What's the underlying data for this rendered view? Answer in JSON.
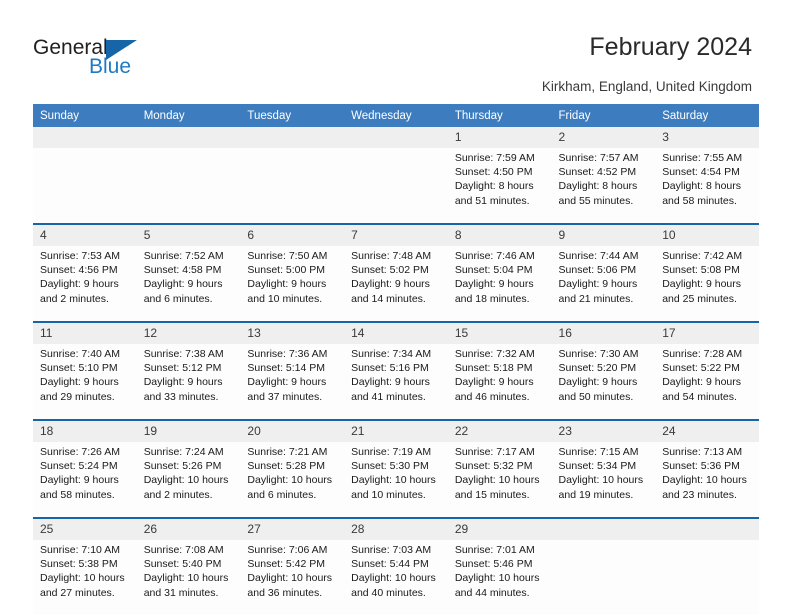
{
  "brand": {
    "name_part1": "General",
    "name_part2": "Blue",
    "accent_color": "#1565a8"
  },
  "header": {
    "title": "February 2024",
    "subtitle": "Kirkham, England, United Kingdom"
  },
  "theme": {
    "header_row_bg": "#3d7cbf",
    "week_separator": "#1565a8",
    "daynum_band": "#efefef"
  },
  "calendar": {
    "weekday_headers": [
      "Sunday",
      "Monday",
      "Tuesday",
      "Wednesday",
      "Thursday",
      "Friday",
      "Saturday"
    ],
    "weeks": [
      [
        {
          "day": "",
          "lines": [
            "",
            "",
            "",
            ""
          ]
        },
        {
          "day": "",
          "lines": [
            "",
            "",
            "",
            ""
          ]
        },
        {
          "day": "",
          "lines": [
            "",
            "",
            "",
            ""
          ]
        },
        {
          "day": "",
          "lines": [
            "",
            "",
            "",
            ""
          ]
        },
        {
          "day": "1",
          "lines": [
            "Sunrise: 7:59 AM",
            "Sunset: 4:50 PM",
            "Daylight: 8 hours",
            "and 51 minutes."
          ]
        },
        {
          "day": "2",
          "lines": [
            "Sunrise: 7:57 AM",
            "Sunset: 4:52 PM",
            "Daylight: 8 hours",
            "and 55 minutes."
          ]
        },
        {
          "day": "3",
          "lines": [
            "Sunrise: 7:55 AM",
            "Sunset: 4:54 PM",
            "Daylight: 8 hours",
            "and 58 minutes."
          ]
        }
      ],
      [
        {
          "day": "4",
          "lines": [
            "Sunrise: 7:53 AM",
            "Sunset: 4:56 PM",
            "Daylight: 9 hours",
            "and 2 minutes."
          ]
        },
        {
          "day": "5",
          "lines": [
            "Sunrise: 7:52 AM",
            "Sunset: 4:58 PM",
            "Daylight: 9 hours",
            "and 6 minutes."
          ]
        },
        {
          "day": "6",
          "lines": [
            "Sunrise: 7:50 AM",
            "Sunset: 5:00 PM",
            "Daylight: 9 hours",
            "and 10 minutes."
          ]
        },
        {
          "day": "7",
          "lines": [
            "Sunrise: 7:48 AM",
            "Sunset: 5:02 PM",
            "Daylight: 9 hours",
            "and 14 minutes."
          ]
        },
        {
          "day": "8",
          "lines": [
            "Sunrise: 7:46 AM",
            "Sunset: 5:04 PM",
            "Daylight: 9 hours",
            "and 18 minutes."
          ]
        },
        {
          "day": "9",
          "lines": [
            "Sunrise: 7:44 AM",
            "Sunset: 5:06 PM",
            "Daylight: 9 hours",
            "and 21 minutes."
          ]
        },
        {
          "day": "10",
          "lines": [
            "Sunrise: 7:42 AM",
            "Sunset: 5:08 PM",
            "Daylight: 9 hours",
            "and 25 minutes."
          ]
        }
      ],
      [
        {
          "day": "11",
          "lines": [
            "Sunrise: 7:40 AM",
            "Sunset: 5:10 PM",
            "Daylight: 9 hours",
            "and 29 minutes."
          ]
        },
        {
          "day": "12",
          "lines": [
            "Sunrise: 7:38 AM",
            "Sunset: 5:12 PM",
            "Daylight: 9 hours",
            "and 33 minutes."
          ]
        },
        {
          "day": "13",
          "lines": [
            "Sunrise: 7:36 AM",
            "Sunset: 5:14 PM",
            "Daylight: 9 hours",
            "and 37 minutes."
          ]
        },
        {
          "day": "14",
          "lines": [
            "Sunrise: 7:34 AM",
            "Sunset: 5:16 PM",
            "Daylight: 9 hours",
            "and 41 minutes."
          ]
        },
        {
          "day": "15",
          "lines": [
            "Sunrise: 7:32 AM",
            "Sunset: 5:18 PM",
            "Daylight: 9 hours",
            "and 46 minutes."
          ]
        },
        {
          "day": "16",
          "lines": [
            "Sunrise: 7:30 AM",
            "Sunset: 5:20 PM",
            "Daylight: 9 hours",
            "and 50 minutes."
          ]
        },
        {
          "day": "17",
          "lines": [
            "Sunrise: 7:28 AM",
            "Sunset: 5:22 PM",
            "Daylight: 9 hours",
            "and 54 minutes."
          ]
        }
      ],
      [
        {
          "day": "18",
          "lines": [
            "Sunrise: 7:26 AM",
            "Sunset: 5:24 PM",
            "Daylight: 9 hours",
            "and 58 minutes."
          ]
        },
        {
          "day": "19",
          "lines": [
            "Sunrise: 7:24 AM",
            "Sunset: 5:26 PM",
            "Daylight: 10 hours",
            "and 2 minutes."
          ]
        },
        {
          "day": "20",
          "lines": [
            "Sunrise: 7:21 AM",
            "Sunset: 5:28 PM",
            "Daylight: 10 hours",
            "and 6 minutes."
          ]
        },
        {
          "day": "21",
          "lines": [
            "Sunrise: 7:19 AM",
            "Sunset: 5:30 PM",
            "Daylight: 10 hours",
            "and 10 minutes."
          ]
        },
        {
          "day": "22",
          "lines": [
            "Sunrise: 7:17 AM",
            "Sunset: 5:32 PM",
            "Daylight: 10 hours",
            "and 15 minutes."
          ]
        },
        {
          "day": "23",
          "lines": [
            "Sunrise: 7:15 AM",
            "Sunset: 5:34 PM",
            "Daylight: 10 hours",
            "and 19 minutes."
          ]
        },
        {
          "day": "24",
          "lines": [
            "Sunrise: 7:13 AM",
            "Sunset: 5:36 PM",
            "Daylight: 10 hours",
            "and 23 minutes."
          ]
        }
      ],
      [
        {
          "day": "25",
          "lines": [
            "Sunrise: 7:10 AM",
            "Sunset: 5:38 PM",
            "Daylight: 10 hours",
            "and 27 minutes."
          ]
        },
        {
          "day": "26",
          "lines": [
            "Sunrise: 7:08 AM",
            "Sunset: 5:40 PM",
            "Daylight: 10 hours",
            "and 31 minutes."
          ]
        },
        {
          "day": "27",
          "lines": [
            "Sunrise: 7:06 AM",
            "Sunset: 5:42 PM",
            "Daylight: 10 hours",
            "and 36 minutes."
          ]
        },
        {
          "day": "28",
          "lines": [
            "Sunrise: 7:03 AM",
            "Sunset: 5:44 PM",
            "Daylight: 10 hours",
            "and 40 minutes."
          ]
        },
        {
          "day": "29",
          "lines": [
            "Sunrise: 7:01 AM",
            "Sunset: 5:46 PM",
            "Daylight: 10 hours",
            "and 44 minutes."
          ]
        },
        {
          "day": "",
          "lines": [
            "",
            "",
            "",
            ""
          ]
        },
        {
          "day": "",
          "lines": [
            "",
            "",
            "",
            ""
          ]
        }
      ]
    ]
  }
}
